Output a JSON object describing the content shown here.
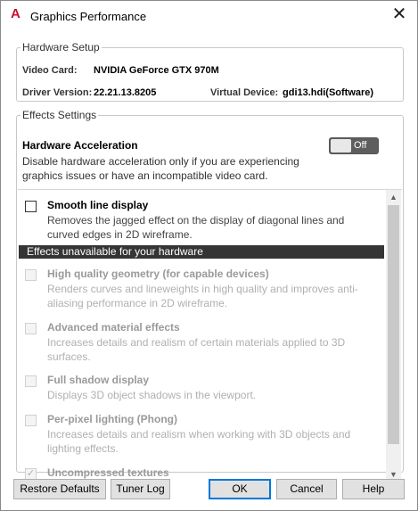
{
  "window": {
    "title": "Graphics Performance",
    "close_symbol": "✕",
    "app_icon_letter": "A",
    "accent": "#c8102e"
  },
  "hardware": {
    "legend": "Hardware Setup",
    "video_card_label": "Video Card:",
    "video_card_value": "NVIDIA GeForce GTX 970M",
    "driver_label": "Driver Version:",
    "driver_value": "22.21.13.8205",
    "virtual_label": "Virtual Device:",
    "virtual_value": "gdi13.hdi(Software)"
  },
  "effects": {
    "legend": "Effects Settings",
    "ha_title": "Hardware Acceleration",
    "ha_desc": "Disable hardware acceleration only if you are experiencing graphics issues or have an incompatible video card.",
    "toggle_label": "Off",
    "unavailable_header": "Effects unavailable for your hardware",
    "items": [
      {
        "title": "Smooth line display",
        "desc": "Removes the jagged effect on the display of diagonal lines and curved edges in 2D wireframe.",
        "checked": false,
        "enabled": true
      },
      {
        "title": "High quality geometry (for capable devices)",
        "desc": "Renders curves and lineweights in high quality and improves anti-aliasing performance in 2D wireframe.",
        "checked": false,
        "enabled": false
      },
      {
        "title": "Advanced material effects",
        "desc": "Increases details and realism of certain materials applied to 3D surfaces.",
        "checked": false,
        "enabled": false
      },
      {
        "title": "Full shadow display",
        "desc": "Displays 3D object shadows in the viewport.",
        "checked": false,
        "enabled": false
      },
      {
        "title": "Per-pixel lighting (Phong)",
        "desc": "Increases details and realism when working with 3D objects and lighting effects.",
        "checked": false,
        "enabled": false
      },
      {
        "title": "Uncompressed textures",
        "desc": "",
        "checked": true,
        "enabled": false
      }
    ]
  },
  "buttons": {
    "restore": "Restore Defaults",
    "tuner": "Tuner Log",
    "ok": "OK",
    "cancel": "Cancel",
    "help": "Help"
  }
}
